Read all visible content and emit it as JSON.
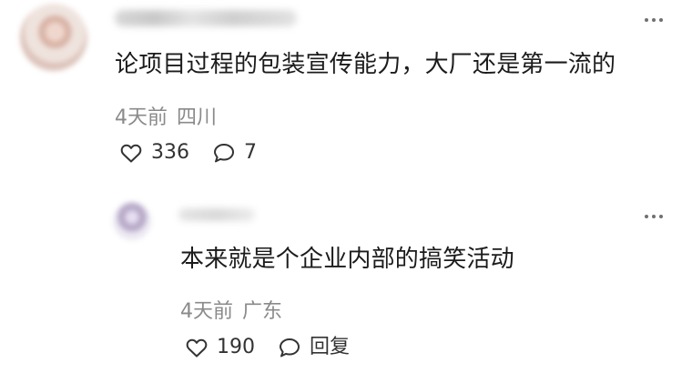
{
  "comments": [
    {
      "text": "论项目过程的包装宣传能力，大厂还是第一流的",
      "time": "4天前",
      "location": "四川",
      "likes": "336",
      "replies": "7"
    },
    {
      "text": "本来就是个企业内部的搞笑活动",
      "time": "4天前",
      "location": "广东",
      "likes": "190",
      "reply_label": "回复"
    }
  ],
  "icons": {
    "more": "more-icon",
    "like": "heart-icon",
    "reply": "comment-bubble-icon"
  },
  "colors": {
    "text": "#1b1b1b",
    "meta": "#8a8a8a",
    "icon": "#333333"
  }
}
